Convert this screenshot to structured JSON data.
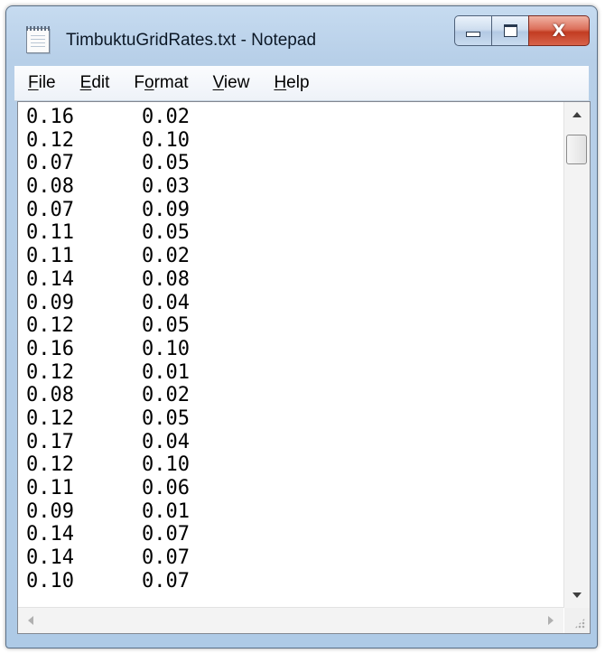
{
  "window": {
    "title": "TimbuktuGridRates.txt - Notepad",
    "icon": "notepad-icon",
    "controls": {
      "minimize_icon": "minimize-icon",
      "maximize_icon": "maximize-icon",
      "close_glyph": "X"
    }
  },
  "menu": {
    "file": {
      "accel": "F",
      "rest": "ile"
    },
    "edit": {
      "accel": "E",
      "rest": "dit"
    },
    "format": {
      "pre": "F",
      "accel": "o",
      "rest": "rmat"
    },
    "view": {
      "accel": "V",
      "rest": "iew"
    },
    "help": {
      "accel": "H",
      "rest": "elp"
    }
  },
  "document": {
    "lines": [
      [
        "0.16",
        "0.02"
      ],
      [
        "0.12",
        "0.10"
      ],
      [
        "0.07",
        "0.05"
      ],
      [
        "0.08",
        "0.03"
      ],
      [
        "0.07",
        "0.09"
      ],
      [
        "0.11",
        "0.05"
      ],
      [
        "0.11",
        "0.02"
      ],
      [
        "0.14",
        "0.08"
      ],
      [
        "0.09",
        "0.04"
      ],
      [
        "0.12",
        "0.05"
      ],
      [
        "0.16",
        "0.10"
      ],
      [
        "0.12",
        "0.01"
      ],
      [
        "0.08",
        "0.02"
      ],
      [
        "0.12",
        "0.05"
      ],
      [
        "0.17",
        "0.04"
      ],
      [
        "0.12",
        "0.10"
      ],
      [
        "0.11",
        "0.06"
      ],
      [
        "0.09",
        "0.01"
      ],
      [
        "0.14",
        "0.07"
      ],
      [
        "0.14",
        "0.07"
      ],
      [
        "0.10",
        "0.07"
      ]
    ]
  },
  "colors": {
    "close_button": "#c23c22",
    "title_text": "#0c1826",
    "frame": "#b7cfe8"
  }
}
